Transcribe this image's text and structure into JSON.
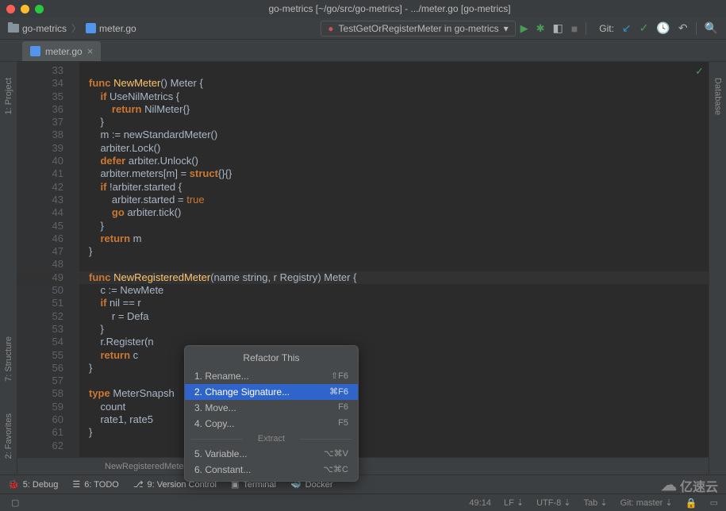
{
  "window": {
    "title": "go-metrics [~/go/src/go-metrics] - .../meter.go [go-metrics]"
  },
  "breadcrumb": {
    "project": "go-metrics",
    "file": "meter.go"
  },
  "run_config": {
    "label": "TestGetOrRegisterMeter in go-metrics"
  },
  "git": {
    "label": "Git:"
  },
  "tabs": [
    {
      "label": "meter.go"
    }
  ],
  "side_tools_left": [
    "1: Project",
    "7: Structure",
    "2: Favorites"
  ],
  "side_tools_right": [
    "Database"
  ],
  "gutter": {
    "start": 33,
    "end": 62,
    "highlight": 49
  },
  "code_lines": [
    "",
    "<span class='kw'>func</span> <span class='fn'>NewMeter</span>() <span class='typ'>Meter</span> {",
    "    <span class='kw'>if</span> UseNilMetrics {",
    "        <span class='kw'>return</span> NilMeter{}",
    "    }",
    "    m := newStandardMeter()",
    "    arbiter.Lock()",
    "    <span class='kw'>defer</span> arbiter.Unlock()",
    "    arbiter.meters[m] = <span class='kw'>struct</span>{}{}",
    "    <span class='kw'>if</span> !arbiter.started {",
    "        arbiter.started = <span class='bool'>true</span>",
    "        <span class='kw'>go</span> arbiter.tick()",
    "    }",
    "    <span class='kw'>return</span> m",
    "}",
    "",
    "<span class='kw'>func</span> <span class='fn'>NewRegisteredMeter</span>(name <span class='typ'>string</span>, r <span class='typ'>Registry</span>) <span class='typ'>Meter</span> {",
    "    c := NewMete",
    "    <span class='kw'>if</span> nil == r",
    "        r = Defa",
    "    }",
    "    r.Register(n",
    "    <span class='kw'>return</span> c",
    "}",
    "",
    "<span class='kw'>type</span> <span class='typ'>MeterSnapsh</span>",
    "    count",
    "    rate1, rate5",
    "}",
    ""
  ],
  "menu": {
    "title": "Refactor This",
    "items": [
      {
        "label": "1. Rename...",
        "shortcut": "⇧F6",
        "selected": false
      },
      {
        "label": "2. Change Signature...",
        "shortcut": "⌘F6",
        "selected": true
      },
      {
        "label": "3. Move...",
        "shortcut": "F6",
        "selected": false
      },
      {
        "label": "4. Copy...",
        "shortcut": "F5",
        "selected": false
      }
    ],
    "sep": "Extract",
    "items2": [
      {
        "label": "5. Variable...",
        "shortcut": "⌥⌘V"
      },
      {
        "label": "6. Constant...",
        "shortcut": "⌥⌘C"
      }
    ]
  },
  "code_breadcrumb": "NewRegisteredMeter(name string, r Registry) Meter",
  "bottom_tools": {
    "debug": "5: Debug",
    "todo": "6: TODO",
    "vcs": "9: Version Control",
    "terminal": "Terminal",
    "docker": "Docker"
  },
  "status": {
    "pos": "49:14",
    "le": "LF",
    "enc": "UTF-8",
    "indent": "Tab",
    "branch": "Git: master"
  },
  "watermark": "亿速云"
}
